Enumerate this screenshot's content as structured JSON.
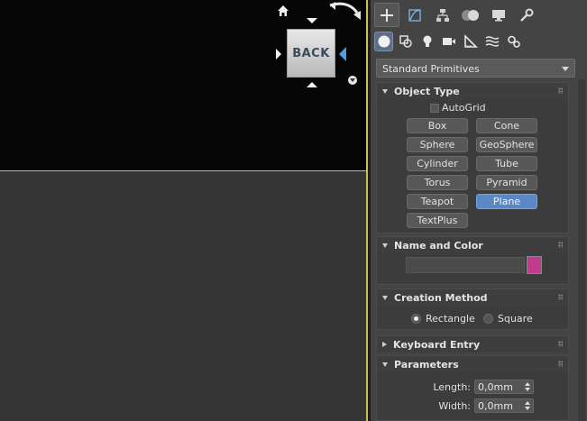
{
  "viewcube": {
    "face_label": "BACK",
    "home_icon": "home-icon",
    "orbit_icon": "orbit-arrow-icon",
    "accent_color": "#4aa0e6"
  },
  "command_panel": {
    "tabs": [
      {
        "name": "create",
        "icon": "plus-icon",
        "active": true
      },
      {
        "name": "modify",
        "icon": "modify-curve-icon",
        "active": false
      },
      {
        "name": "hierarchy",
        "icon": "hierarchy-icon",
        "active": false
      },
      {
        "name": "motion",
        "icon": "motion-icon",
        "active": false
      },
      {
        "name": "display",
        "icon": "monitor-icon",
        "active": false
      },
      {
        "name": "utilities",
        "icon": "wrench-icon",
        "active": false
      }
    ],
    "categories": [
      {
        "name": "geometry",
        "icon": "sphere-icon",
        "active": true
      },
      {
        "name": "shapes",
        "icon": "shapes-icon",
        "active": false
      },
      {
        "name": "lights",
        "icon": "lightbulb-icon",
        "active": false
      },
      {
        "name": "cameras",
        "icon": "camera-icon",
        "active": false
      },
      {
        "name": "helpers",
        "icon": "ruler-triangle-icon",
        "active": false
      },
      {
        "name": "space-warps",
        "icon": "waves-icon",
        "active": false
      },
      {
        "name": "systems",
        "icon": "gears-icon",
        "active": false
      }
    ],
    "dropdown_value": "Standard Primitives",
    "object_type": {
      "title": "Object Type",
      "autogrid_label": "AutoGrid",
      "buttons": [
        "Box",
        "Cone",
        "Sphere",
        "GeoSphere",
        "Cylinder",
        "Tube",
        "Torus",
        "Pyramid",
        "Teapot",
        "Plane",
        "TextPlus"
      ],
      "active_button": "Plane"
    },
    "name_and_color": {
      "title": "Name and Color",
      "name_value": "",
      "color": "#c23a8e"
    },
    "creation_method": {
      "title": "Creation Method",
      "options": [
        "Rectangle",
        "Square"
      ],
      "selected": "Rectangle"
    },
    "keyboard_entry": {
      "title": "Keyboard Entry"
    },
    "parameters": {
      "title": "Parameters",
      "length_label": "Length:",
      "length_value": "0,0mm",
      "width_label": "Width:",
      "width_value": "0,0mm"
    }
  }
}
